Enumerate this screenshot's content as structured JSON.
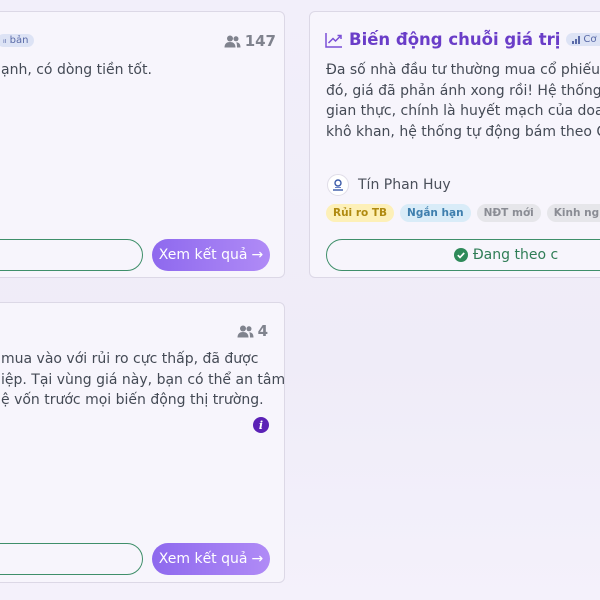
{
  "cards": [
    {
      "tag": "ᵢₗ bản",
      "followers": "147",
      "description_lines": [
        "ạnh, có dòng tiền tốt."
      ],
      "result_label": "Xem kết quả",
      "arrow": "→"
    },
    {
      "title": "Biến động chuỗi giá trị",
      "tag": "Cơ bản",
      "description_lines": [
        "Đa số nhà đầu tư thường mua cổ phiếu sa",
        "đó, giá đã phản ánh xong rồi! Hệ thống th",
        "gian thực, chính là huyết mạch của doanh",
        "khô khan, hệ thống tự động bám theo Câ"
      ],
      "author": "Tín Phan Huy",
      "chips": [
        "Rủi ro TB",
        "Ngắn hạn",
        "NĐT mới",
        "Kinh nghiệ"
      ],
      "following_label": "Đang theo c"
    },
    {
      "followers": "4",
      "description_lines": [
        "mua vào với rủi ro cực thấp, đã được",
        "iệp. Tại vùng giá này, bạn có thể an tâm",
        "ệ vốn trước mọi biến động thị trường."
      ],
      "info_glyph": "i",
      "result_label": "Xem kết quả",
      "arrow": "→"
    }
  ],
  "icons": {
    "followers": "users-icon",
    "trend": "trending-up-icon",
    "check": "check-circle-icon",
    "info": "info-icon"
  },
  "colors": {
    "accent_purple": "#6a3dc8",
    "button_gradient_start": "#8e69ee",
    "button_gradient_end": "#b08bf6",
    "follow_green": "#3f8f6a"
  }
}
